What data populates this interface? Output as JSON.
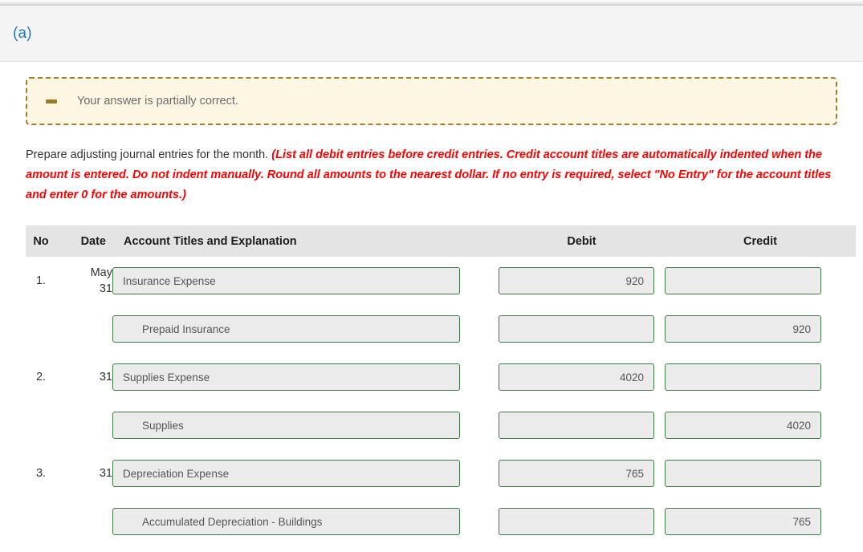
{
  "part": {
    "label": "(a)"
  },
  "alert": {
    "icon": "minus-icon",
    "message": "Your answer is partially correct."
  },
  "instructions": {
    "lead": "Prepare adjusting journal entries for the month.",
    "hint": "(List all debit entries before credit entries. Credit account titles are automatically indented when the amount is entered. Do not indent manually. Round all amounts to the nearest dollar. If no entry is required, select \"No Entry\" for the account titles and enter 0 for the amounts.)"
  },
  "table": {
    "headers": {
      "no": "No",
      "date": "Date",
      "account": "Account Titles and Explanation",
      "debit": "Debit",
      "credit": "Credit"
    },
    "rows": [
      {
        "no": "1.",
        "date_month": "May",
        "date_day": "31",
        "account": "Insurance Expense",
        "debit": "920",
        "credit": "",
        "indented": false
      },
      {
        "no": "",
        "date_month": "",
        "date_day": "",
        "account": "Prepaid Insurance",
        "debit": "",
        "credit": "920",
        "indented": true
      },
      {
        "no": "2.",
        "date_month": "",
        "date_day": "31",
        "account": "Supplies Expense",
        "debit": "4020",
        "credit": "",
        "indented": false
      },
      {
        "no": "",
        "date_month": "",
        "date_day": "",
        "account": "Supplies",
        "debit": "",
        "credit": "4020",
        "indented": true
      },
      {
        "no": "3.",
        "date_month": "",
        "date_day": "31",
        "account": "Depreciation Expense",
        "debit": "765",
        "credit": "",
        "indented": false
      },
      {
        "no": "",
        "date_month": "",
        "date_day": "",
        "account": "Accumulated Depreciation - Buildings",
        "debit": "",
        "credit": "765",
        "indented": true
      }
    ]
  },
  "colors": {
    "part_label": "#1f7bb6",
    "alert_bg": "#fdf6e3",
    "alert_border": "#a07d28",
    "hint_text": "#ff0000",
    "field_border": "#3f7c43",
    "field_bg": "#ebebeb",
    "header_bg": "#e4e4e4"
  }
}
